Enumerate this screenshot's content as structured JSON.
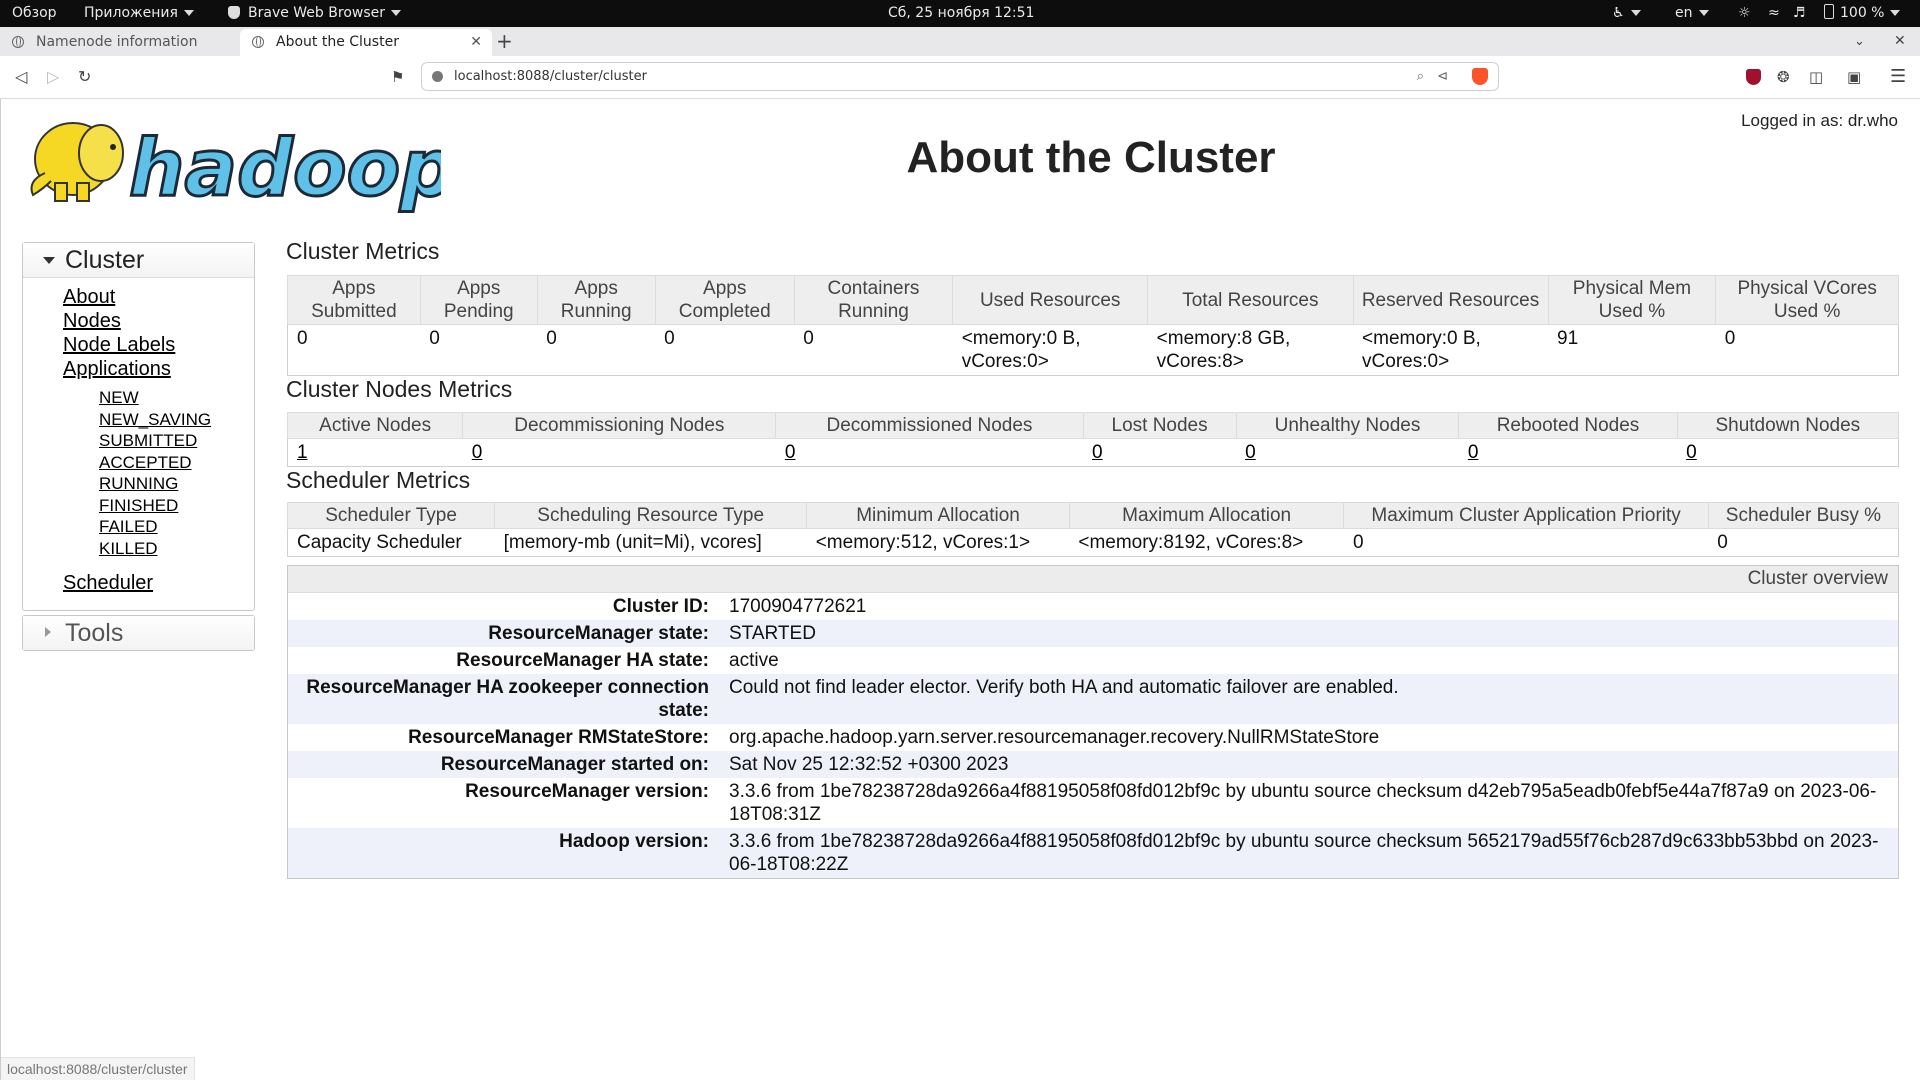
{
  "system_bar": {
    "activities": "Обзор",
    "applications": "Приложения",
    "browser_name": "Brave Web Browser",
    "datetime": "Сб, 25 ноября  12:51",
    "language": "en",
    "battery": "100 %"
  },
  "tabs": [
    {
      "label": "Namenode information"
    },
    {
      "label": "About the Cluster"
    }
  ],
  "address_bar": {
    "url": "localhost:8088/cluster/cluster"
  },
  "header": {
    "logged_in": "Logged in as: dr.who",
    "title": "About the Cluster",
    "logo_text": "hadoop"
  },
  "nav": {
    "cluster_heading": "Cluster",
    "links": [
      "About",
      "Nodes",
      "Node Labels",
      "Applications"
    ],
    "app_states": [
      "NEW",
      "NEW_SAVING",
      "SUBMITTED",
      "ACCEPTED",
      "RUNNING",
      "FINISHED",
      "FAILED",
      "KILLED"
    ],
    "scheduler": "Scheduler",
    "tools_heading": "Tools"
  },
  "cluster_metrics": {
    "title": "Cluster Metrics",
    "headers": [
      "Apps Submitted",
      "Apps Pending",
      "Apps Running",
      "Apps Completed",
      "Containers Running",
      "Used Resources",
      "Total Resources",
      "Reserved Resources",
      "Physical Mem Used %",
      "Physical VCores Used %"
    ],
    "values": [
      "0",
      "0",
      "0",
      "0",
      "0",
      "<memory:0 B, vCores:0>",
      "<memory:8 GB, vCores:8>",
      "<memory:0 B, vCores:0>",
      "91",
      "0"
    ]
  },
  "nodes_metrics": {
    "title": "Cluster Nodes Metrics",
    "headers": [
      "Active Nodes",
      "Decommissioning Nodes",
      "Decommissioned Nodes",
      "Lost Nodes",
      "Unhealthy Nodes",
      "Rebooted Nodes",
      "Shutdown Nodes"
    ],
    "values": [
      "1",
      "0",
      "0",
      "0",
      "0",
      "0",
      "0"
    ]
  },
  "scheduler_metrics": {
    "title": "Scheduler Metrics",
    "headers": [
      "Scheduler Type",
      "Scheduling Resource Type",
      "Minimum Allocation",
      "Maximum Allocation",
      "Maximum Cluster Application Priority",
      "Scheduler Busy %"
    ],
    "values": [
      "Capacity Scheduler",
      "[memory-mb (unit=Mi), vcores]",
      "<memory:512, vCores:1>",
      "<memory:8192, vCores:8>",
      "0",
      "0"
    ]
  },
  "overview": {
    "heading": "Cluster overview",
    "rows": [
      {
        "label": "Cluster ID:",
        "value": "1700904772621"
      },
      {
        "label": "ResourceManager state:",
        "value": "STARTED"
      },
      {
        "label": "ResourceManager HA state:",
        "value": "active"
      },
      {
        "label": "ResourceManager HA zookeeper connection state:",
        "value": "Could not find leader elector. Verify both HA and automatic failover are enabled."
      },
      {
        "label": "ResourceManager RMStateStore:",
        "value": "org.apache.hadoop.yarn.server.resourcemanager.recovery.NullRMStateStore"
      },
      {
        "label": "ResourceManager started on:",
        "value": "Sat Nov 25 12:32:52 +0300 2023"
      },
      {
        "label": "ResourceManager version:",
        "value": "3.3.6 from 1be78238728da9266a4f88195058f08fd012bf9c by ubuntu source checksum d42eb795a5eadb0febf5e44a7f87a9 on 2023-06-18T08:31Z"
      },
      {
        "label": "Hadoop version:",
        "value": "3.3.6 from 1be78238728da9266a4f88195058f08fd012bf9c by ubuntu source checksum 5652179ad55f76cb287d9c633bb53bbd on 2023-06-18T08:22Z"
      }
    ]
  },
  "status_bar": {
    "hover_url": "localhost:8088/cluster/cluster"
  },
  "colors": {
    "logo_yellow": "#f4d823",
    "logo_blue": "#5fc0e8",
    "accent": "#000000"
  }
}
